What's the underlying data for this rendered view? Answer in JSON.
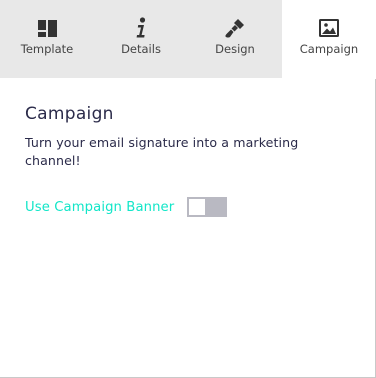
{
  "tabs": [
    {
      "label": "Template",
      "icon": "template-layout-icon",
      "active": false
    },
    {
      "label": "Details",
      "icon": "info-icon",
      "active": false
    },
    {
      "label": "Design",
      "icon": "paintbrush-icon",
      "active": false
    },
    {
      "label": "Campaign",
      "icon": "image-icon",
      "active": true
    }
  ],
  "campaign": {
    "title": "Campaign",
    "description": "Turn your email signature into a marketing channel!",
    "banner_toggle_label": "Use Campaign Banner",
    "banner_enabled": false
  },
  "colors": {
    "accent": "#12e6c8",
    "text": "#2b2b4a",
    "tabbar_bg": "#e8e8e8",
    "toggle_off": "#b9b9c2"
  }
}
